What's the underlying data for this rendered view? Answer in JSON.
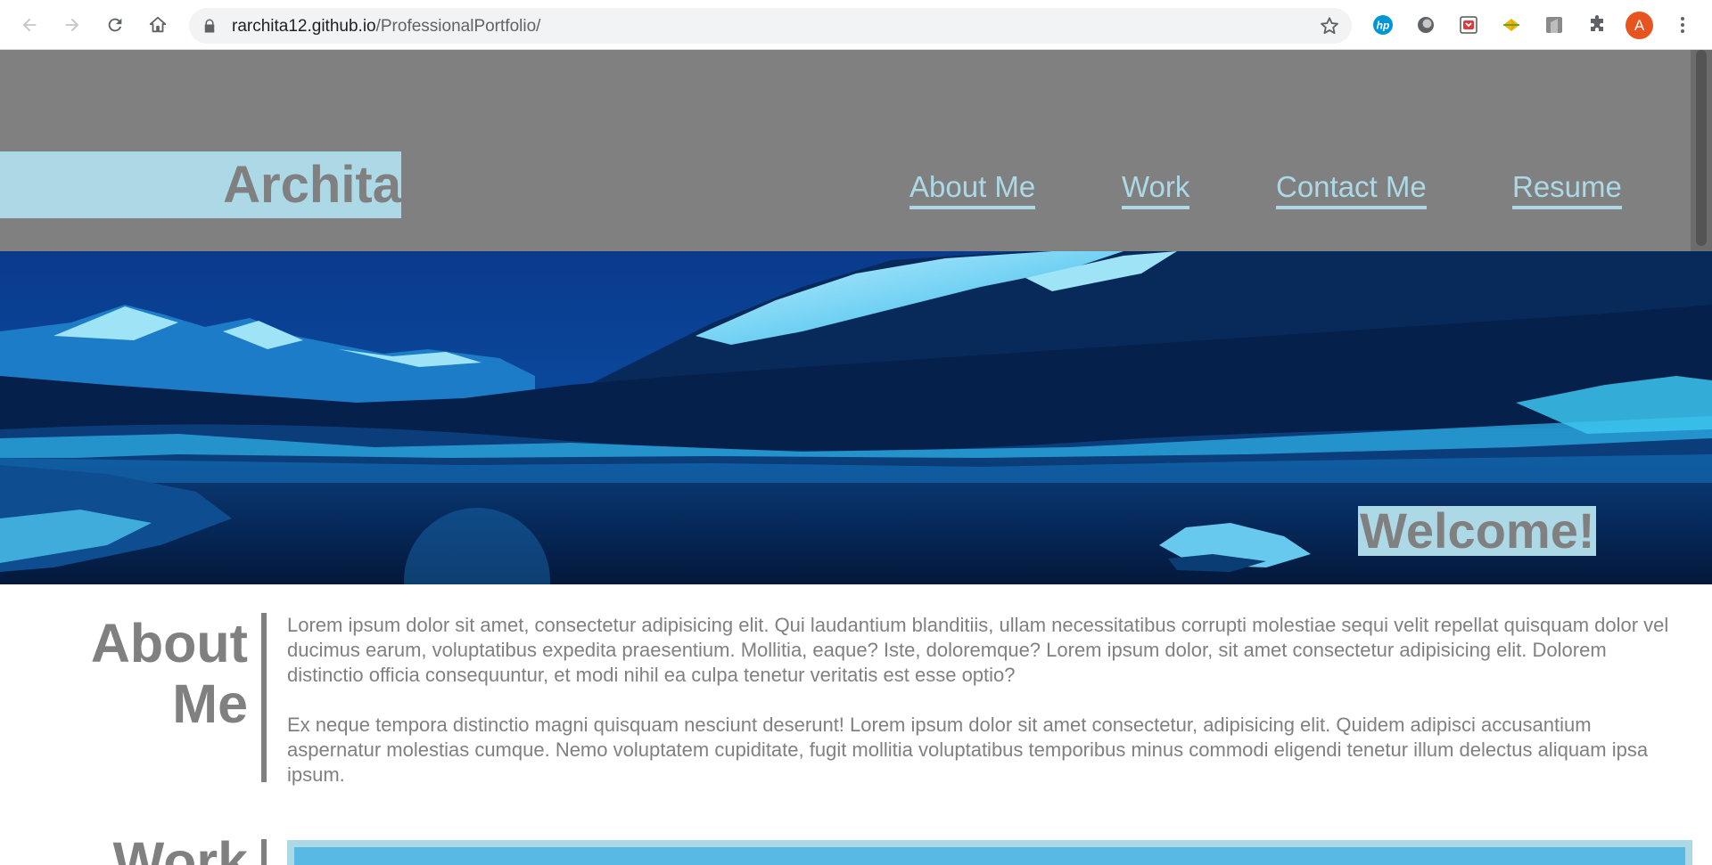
{
  "browser": {
    "url_host": "rarchita12.github.io",
    "url_path": "/ProfessionalPortfolio/",
    "profile_initial": "A",
    "icons": [
      "back-arrow-icon",
      "forward-arrow-icon",
      "reload-icon",
      "home-icon",
      "lock-icon",
      "star-icon",
      "hp-extension-icon",
      "circle-extension-icon",
      "pocket-extension-icon",
      "diamond-extension-icon",
      "tab-extension-icon",
      "puzzle-extension-icon",
      "kebab-menu-icon"
    ]
  },
  "site": {
    "logo": "Archita",
    "nav": [
      {
        "label": "About Me"
      },
      {
        "label": "Work"
      },
      {
        "label": "Contact Me"
      },
      {
        "label": "Resume"
      }
    ],
    "hero_welcome": "Welcome!",
    "about": {
      "title_line1": "About",
      "title_line2": "Me",
      "paragraphs": [
        "Lorem ipsum dolor sit amet, consectetur adipisicing elit. Qui laudantium blanditiis, ullam necessitatibus corrupti molestiae sequi velit repellat quisquam dolor vel ducimus earum, voluptatibus expedita praesentium. Mollitia, eaque? Iste, doloremque? Lorem ipsum dolor, sit amet consectetur adipisicing elit. Dolorem distinctio officia consequuntur, et modi nihil ea culpa tenetur veritatis est esse optio?",
        "Ex neque tempora distinctio magni quisquam nesciunt deserunt! Lorem ipsum dolor sit amet consectetur, adipisicing elit. Quidem adipisci accusantium aspernatur molestias cumque. Nemo voluptatem cupiditate, fugit mollitia voluptatibus temporibus minus commodi eligendi tenetur illum delectus aliquam ipsa ipsum."
      ]
    },
    "work": {
      "title": "Work"
    }
  },
  "colors": {
    "header_bg": "#808080",
    "accent_light_blue": "#add8e6",
    "text_gray": "#808080",
    "work_card_blue": "#57b9e4",
    "profile_orange": "#e8541f"
  }
}
